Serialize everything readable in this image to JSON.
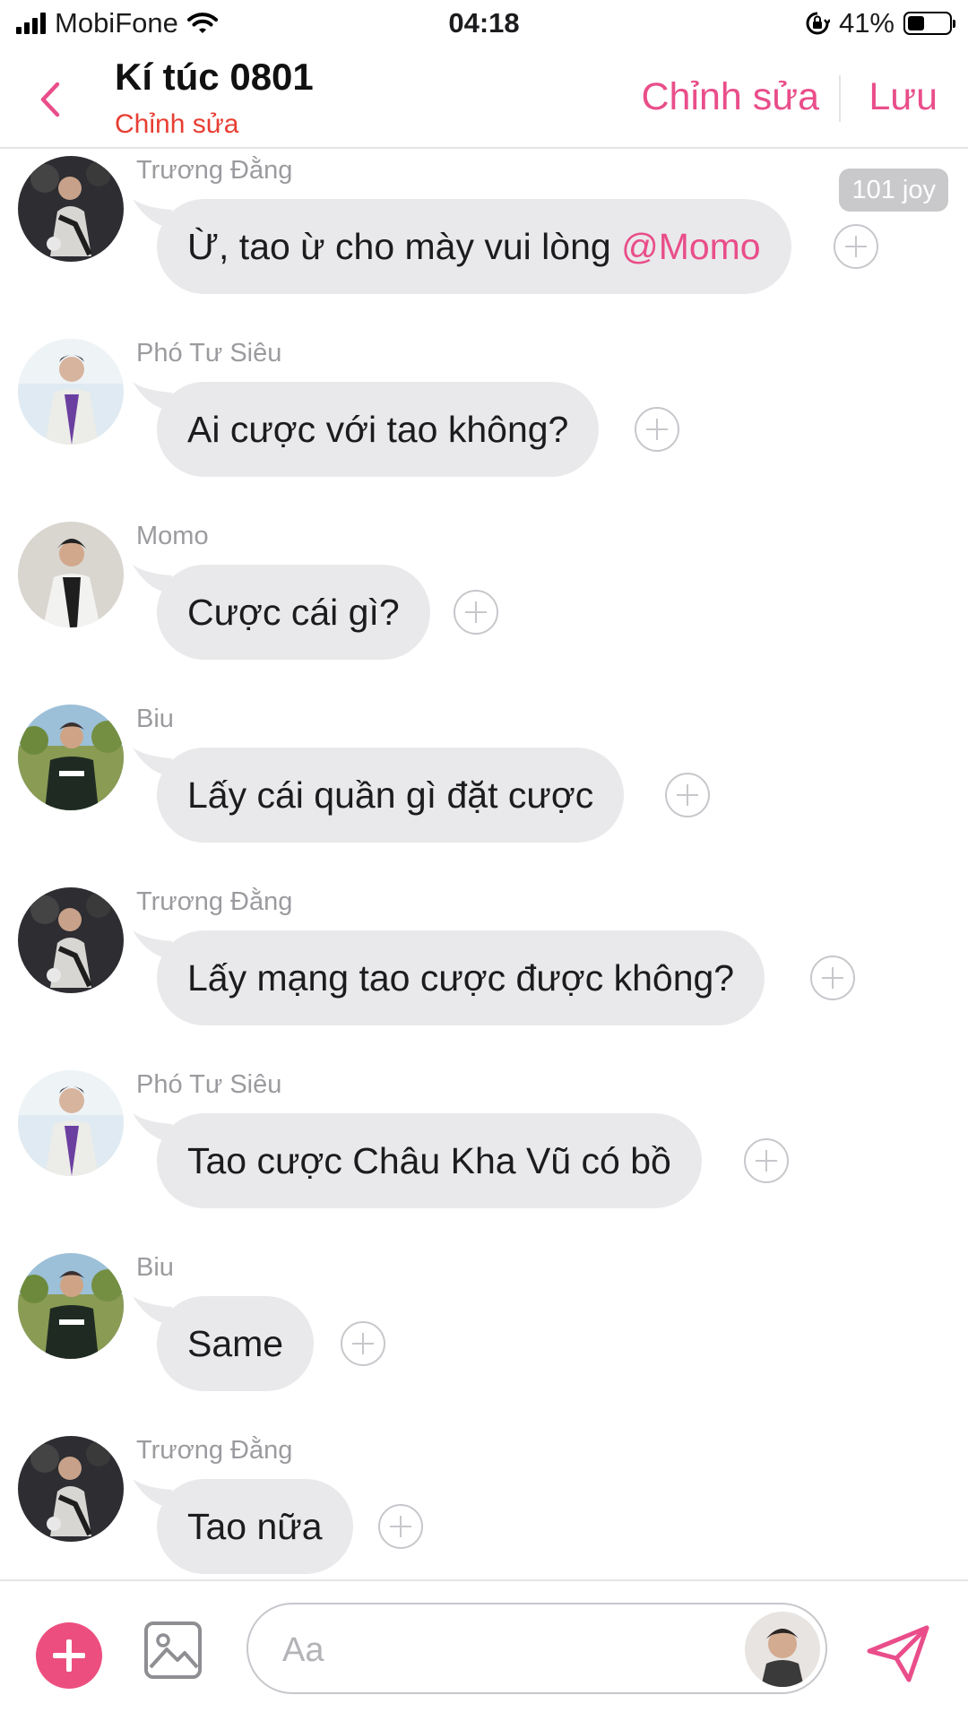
{
  "status_bar": {
    "carrier": "MobiFone",
    "time": "04:18",
    "battery_percent": "41%",
    "battery_level": 0.41
  },
  "header": {
    "title": "Kí túc 0801",
    "subtitle": "Chỉnh sửa",
    "edit_label": "Chỉnh sửa",
    "save_label": "Lưu"
  },
  "messages": [
    {
      "sender": "Trương Đằng",
      "text": "Ừ, tao ừ cho mày vui lòng ",
      "mention": "@Momo",
      "badge": "101 joy"
    },
    {
      "sender": "Phó Tư Siêu",
      "text": "Ai cược với tao không?"
    },
    {
      "sender": "Momo",
      "text": "Cược cái gì?"
    },
    {
      "sender": "Biu",
      "text": "Lấy cái quần gì đặt cược"
    },
    {
      "sender": "Trương Đằng",
      "text": "Lấy mạng tao cược được không?"
    },
    {
      "sender": "Phó Tư Siêu",
      "text": "Tao cược Châu Kha Vũ có bồ"
    },
    {
      "sender": "Biu",
      "text": "Same"
    },
    {
      "sender": "Trương Đằng",
      "text": "Tao nữa"
    }
  ],
  "input": {
    "placeholder": "Aa"
  },
  "colors": {
    "accent": "#e94e8a",
    "subtitle": "#e83e33",
    "bubble": "#e9e9eb",
    "add_button": "#ec4f7f"
  },
  "icons": [
    "signal-icon",
    "wifi-icon",
    "rotation-lock-icon",
    "battery-icon",
    "back-chevron-icon",
    "add-message-icon",
    "image-icon",
    "send-icon"
  ]
}
